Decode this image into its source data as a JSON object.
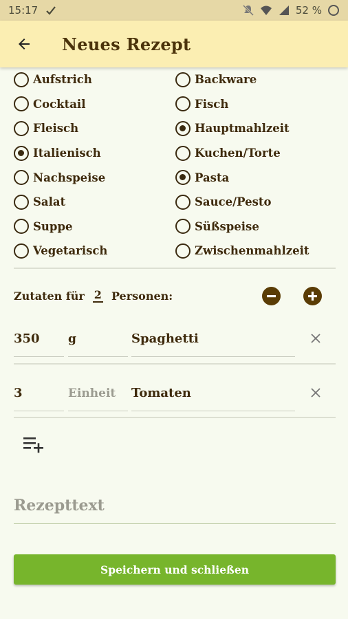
{
  "status_bar": {
    "time": "15:17",
    "battery_text": "52 %"
  },
  "app_bar": {
    "title": "Neues Rezept"
  },
  "categories": [
    {
      "left": {
        "label": "Aufstrich",
        "checked": false
      },
      "right": {
        "label": "Backware",
        "checked": false
      }
    },
    {
      "left": {
        "label": "Cocktail",
        "checked": false
      },
      "right": {
        "label": "Fisch",
        "checked": false
      }
    },
    {
      "left": {
        "label": "Fleisch",
        "checked": false
      },
      "right": {
        "label": "Hauptmahlzeit",
        "checked": true
      }
    },
    {
      "left": {
        "label": "Italienisch",
        "checked": true
      },
      "right": {
        "label": "Kuchen/Torte",
        "checked": false
      }
    },
    {
      "left": {
        "label": "Nachspeise",
        "checked": false
      },
      "right": {
        "label": "Pasta",
        "checked": true
      }
    },
    {
      "left": {
        "label": "Salat",
        "checked": false
      },
      "right": {
        "label": "Sauce/Pesto",
        "checked": false
      }
    },
    {
      "left": {
        "label": "Suppe",
        "checked": false
      },
      "right": {
        "label": "Süßspeise",
        "checked": false
      }
    },
    {
      "left": {
        "label": "Vegetarisch",
        "checked": false
      },
      "right": {
        "label": "Zwischenmahlzeit",
        "checked": false
      }
    }
  ],
  "persons": {
    "prefix": "Zutaten für",
    "count": "2",
    "suffix": "Personen:",
    "minus_icon": "minus-circle-icon",
    "plus_icon": "plus-circle-icon"
  },
  "ingredients": [
    {
      "amount": "350",
      "unit": "g",
      "unit_placeholder": "Einheit",
      "name": "Spaghetti"
    },
    {
      "amount": "3",
      "unit": "",
      "unit_placeholder": "Einheit",
      "name": "Tomaten"
    }
  ],
  "recipe_text": {
    "value": "",
    "placeholder": "Rezepttext"
  },
  "save_button": {
    "label": "Speichern und schließen"
  },
  "colors": {
    "accent_green": "#77b52c",
    "app_bar": "#fbeeb2",
    "brown": "#5a3c05"
  }
}
